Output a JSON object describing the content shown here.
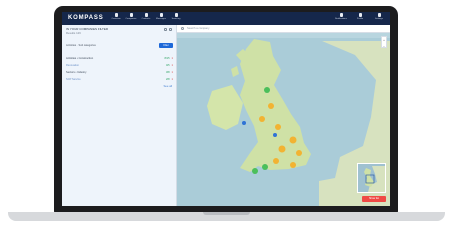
{
  "app": {
    "logo": "KOMPASS"
  },
  "nav": [
    {
      "label": "Overview",
      "icon": "home-icon"
    },
    {
      "label": "Companies",
      "icon": "building-icon"
    },
    {
      "label": "Contacts",
      "icon": "user-icon"
    },
    {
      "label": "Messages",
      "icon": "message-icon"
    },
    {
      "label": "Sourcing",
      "icon": "rocket-icon"
    }
  ],
  "right_nav": [
    {
      "label": "Notifications",
      "icon": "bell-icon"
    },
    {
      "label": "Profile",
      "icon": "avatar-icon"
    },
    {
      "label": "Settings",
      "icon": "gear-icon"
    }
  ],
  "left": {
    "title": "IN YOUR COMPANIES FILTER",
    "subtitle": "Results 126",
    "filters_label": "Activities · Sub categories",
    "filter_button": "Filter",
    "rows": [
      {
        "label": "Activities • Construction",
        "value": "8/15",
        "extra": "1"
      },
      {
        "label": "Renovation",
        "value": "4/5",
        "extra": "1"
      },
      {
        "label": "Sectors • Industry",
        "value": "3/8",
        "extra": "1"
      },
      {
        "label": "SCP Service",
        "value": "2/8",
        "extra": "1"
      }
    ],
    "more_label": "See all"
  },
  "map": {
    "search_placeholder": "Search a company",
    "zoom_in": "+",
    "zoom_out": "−",
    "button_label": "Show list"
  }
}
